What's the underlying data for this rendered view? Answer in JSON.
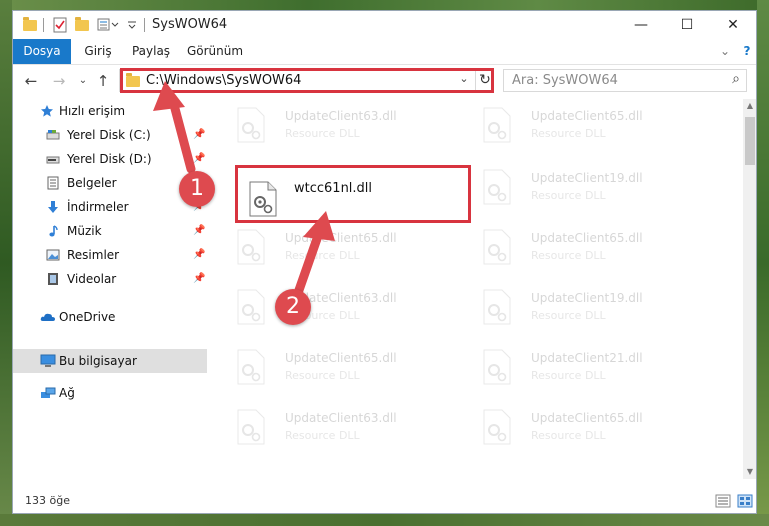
{
  "window": {
    "title": "SysWOW64",
    "minimize": "—",
    "maximize": "☐",
    "close": "✕"
  },
  "ribbon": {
    "tabs": [
      {
        "label": "Dosya",
        "active": true
      },
      {
        "label": "Giriş",
        "active": false
      },
      {
        "label": "Paylaş",
        "active": false
      },
      {
        "label": "Görünüm",
        "active": false
      }
    ],
    "collapse": "⌄",
    "help": "?"
  },
  "nav": {
    "back": "←",
    "forward": "→",
    "recent": "⌄",
    "up": "↑",
    "address": "C:\\Windows\\SysWOW64",
    "dropdown": "⌄",
    "refresh": "↻",
    "search_placeholder": "Ara: SysWOW64",
    "search_icon": "⌕"
  },
  "sidebar": {
    "items": [
      {
        "label": "Hızlı erişim",
        "icon": "star-icon",
        "pinned": false,
        "sub": false
      },
      {
        "label": "Yerel Disk (C:)",
        "icon": "drive-icon",
        "pinned": true,
        "sub": true
      },
      {
        "label": "Yerel Disk (D:)",
        "icon": "drive-icon",
        "pinned": true,
        "sub": true
      },
      {
        "label": "Belgeler",
        "icon": "documents-icon",
        "pinned": true,
        "sub": true
      },
      {
        "label": "İndirmeler",
        "icon": "download-icon",
        "pinned": true,
        "sub": true
      },
      {
        "label": "Müzik",
        "icon": "music-icon",
        "pinned": true,
        "sub": true
      },
      {
        "label": "Resimler",
        "icon": "pictures-icon",
        "pinned": true,
        "sub": true
      },
      {
        "label": "Videolar",
        "icon": "videos-icon",
        "pinned": true,
        "sub": true
      },
      {
        "label": "OneDrive",
        "icon": "cloud-icon",
        "pinned": false,
        "sub": false
      },
      {
        "label": "Bu bilgisayar",
        "icon": "computer-icon",
        "pinned": false,
        "sub": false,
        "selected": true
      },
      {
        "label": "Ağ",
        "icon": "network-icon",
        "pinned": false,
        "sub": false
      }
    ],
    "pin_glyph": "📌"
  },
  "files": {
    "highlighted": {
      "name": "wtcc61nl.dll"
    },
    "left_column": [
      {
        "name": "UpdateClient63.dll",
        "type": "Resource DLL"
      },
      {
        "name": "UpdateClient65.dll",
        "type": "Resource DLL"
      },
      {
        "name": "UpdateClient63.dll",
        "type": "Resource DLL"
      },
      {
        "name": "UpdateClient65.dll",
        "type": "Resource DLL"
      },
      {
        "name": "UpdateClient63.dll",
        "type": "Resource DLL"
      }
    ],
    "right_column": [
      {
        "name": "UpdateClient65.dll",
        "type": "Resource DLL"
      },
      {
        "name": "UpdateClient19.dll",
        "type": "Resource DLL"
      },
      {
        "name": "UpdateClient65.dll",
        "type": "Resource DLL"
      },
      {
        "name": "UpdateClient19.dll",
        "type": "Resource DLL"
      },
      {
        "name": "UpdateClient21.dll",
        "type": "Resource DLL"
      },
      {
        "name": "UpdateClient65.dll",
        "type": "Resource DLL"
      }
    ]
  },
  "status": {
    "count": "133 öğe"
  },
  "annotations": {
    "badge1": "1",
    "badge2": "2",
    "accent": "#d8343f"
  }
}
